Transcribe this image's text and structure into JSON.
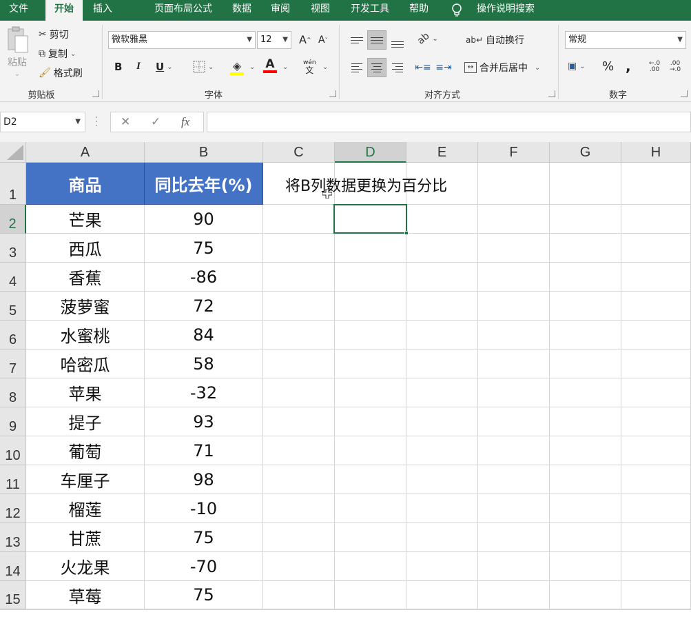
{
  "menu": {
    "tabs": [
      "文件",
      "开始",
      "插入",
      "页面布局",
      "公式",
      "数据",
      "审阅",
      "视图",
      "开发工具",
      "帮助"
    ],
    "active_index": 1,
    "search": "操作说明搜索"
  },
  "ribbon": {
    "clipboard": {
      "paste": "粘贴",
      "cut": "剪切",
      "copy": "复制",
      "format_painter": "格式刷",
      "label": "剪贴板"
    },
    "font": {
      "family": "微软雅黑",
      "size": "12",
      "bold": "B",
      "italic": "I",
      "underline": "U",
      "grow": "A",
      "shrink": "A",
      "font_color": "A",
      "phonetic": "wén",
      "label": "字体",
      "fill_color": "#ffff00",
      "text_color": "#ff0000"
    },
    "alignment": {
      "wrap": "自动换行",
      "merge": "合并后居中",
      "label": "对齐方式"
    },
    "number": {
      "format": "常规",
      "percent": "%",
      "comma": ",",
      "inc_decimal": "←.0\n.00",
      "label": "数字"
    }
  },
  "formula_bar": {
    "name_box": "D2",
    "cancel": "✕",
    "enter": "✓",
    "fx": "fx",
    "value": ""
  },
  "sheet": {
    "columns": [
      "A",
      "B",
      "C",
      "D",
      "E",
      "F",
      "G",
      "H"
    ],
    "selected_column": "D",
    "selected_row": 2,
    "rows": [
      "1",
      "2",
      "3",
      "4",
      "5",
      "6",
      "7",
      "8",
      "9",
      "10",
      "11",
      "12",
      "13",
      "14",
      "15"
    ],
    "header": {
      "a": "商品",
      "b": "同比去年(%)"
    },
    "note": "将B列数据更换为百分比",
    "data": [
      {
        "a": "芒果",
        "b": "90"
      },
      {
        "a": "西瓜",
        "b": "75"
      },
      {
        "a": "香蕉",
        "b": "-86"
      },
      {
        "a": "菠萝蜜",
        "b": "72"
      },
      {
        "a": "水蜜桃",
        "b": "84"
      },
      {
        "a": "哈密瓜",
        "b": "58"
      },
      {
        "a": "苹果",
        "b": "-32"
      },
      {
        "a": "提子",
        "b": "93"
      },
      {
        "a": "葡萄",
        "b": "71"
      },
      {
        "a": "车厘子",
        "b": "98"
      },
      {
        "a": "榴莲",
        "b": "-10"
      },
      {
        "a": "甘蔗",
        "b": "75"
      },
      {
        "a": "火龙果",
        "b": "-70"
      },
      {
        "a": "草莓",
        "b": "75"
      }
    ]
  },
  "colors": {
    "brand": "#217346",
    "header_fill": "#4472c4",
    "selection": "#217346"
  }
}
